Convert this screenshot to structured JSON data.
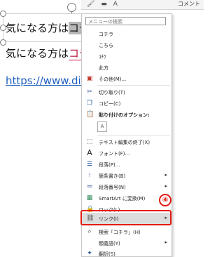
{
  "document": {
    "line1_text": "気になる方は",
    "line1_selected": "コチ",
    "line2_text": "気になる方は",
    "line2_link": "コチ",
    "url_text": "https://www.digip"
  },
  "mini_toolbar": {
    "comment_label": "コメント"
  },
  "context_menu": {
    "search_placeholder": "メニューの検索",
    "items": [
      {
        "label": "コチラ"
      },
      {
        "label": "こちら"
      },
      {
        "label": "ｺﾁﾗ"
      },
      {
        "label": "此方"
      },
      {
        "label": "その他(M)...",
        "icon": "book"
      },
      {
        "label": "切り取り(T)",
        "icon": "scissors"
      },
      {
        "label": "コピー(C)",
        "icon": "copy"
      },
      {
        "label": "貼り付けのオプション:",
        "icon": "clipboard"
      },
      {
        "label": "テキスト編集の終了(X)",
        "icon": "text-box"
      },
      {
        "label": "フォント(F)...",
        "icon": "A"
      },
      {
        "label": "段落(P)...",
        "icon": "paragraph"
      },
      {
        "label": "箇条書き(B)",
        "icon": "bullets"
      },
      {
        "label": "段落番号(N)",
        "icon": "numbering"
      },
      {
        "label": "SmartArt に変換(M)",
        "icon": "smartart"
      },
      {
        "label": "ロック(L)",
        "icon": "lock"
      },
      {
        "label": "リンク(I)",
        "icon": "link"
      },
      {
        "label": "検索「コチラ」(H)",
        "icon": "search"
      },
      {
        "label": "類義語(Y)"
      },
      {
        "label": "翻訳(S)",
        "icon": "translate"
      }
    ]
  },
  "callout": {
    "number": "④"
  },
  "colors": {
    "highlight_red": "#e41b13",
    "link_red": "#c0143c",
    "url_blue": "#1f5fbf"
  }
}
